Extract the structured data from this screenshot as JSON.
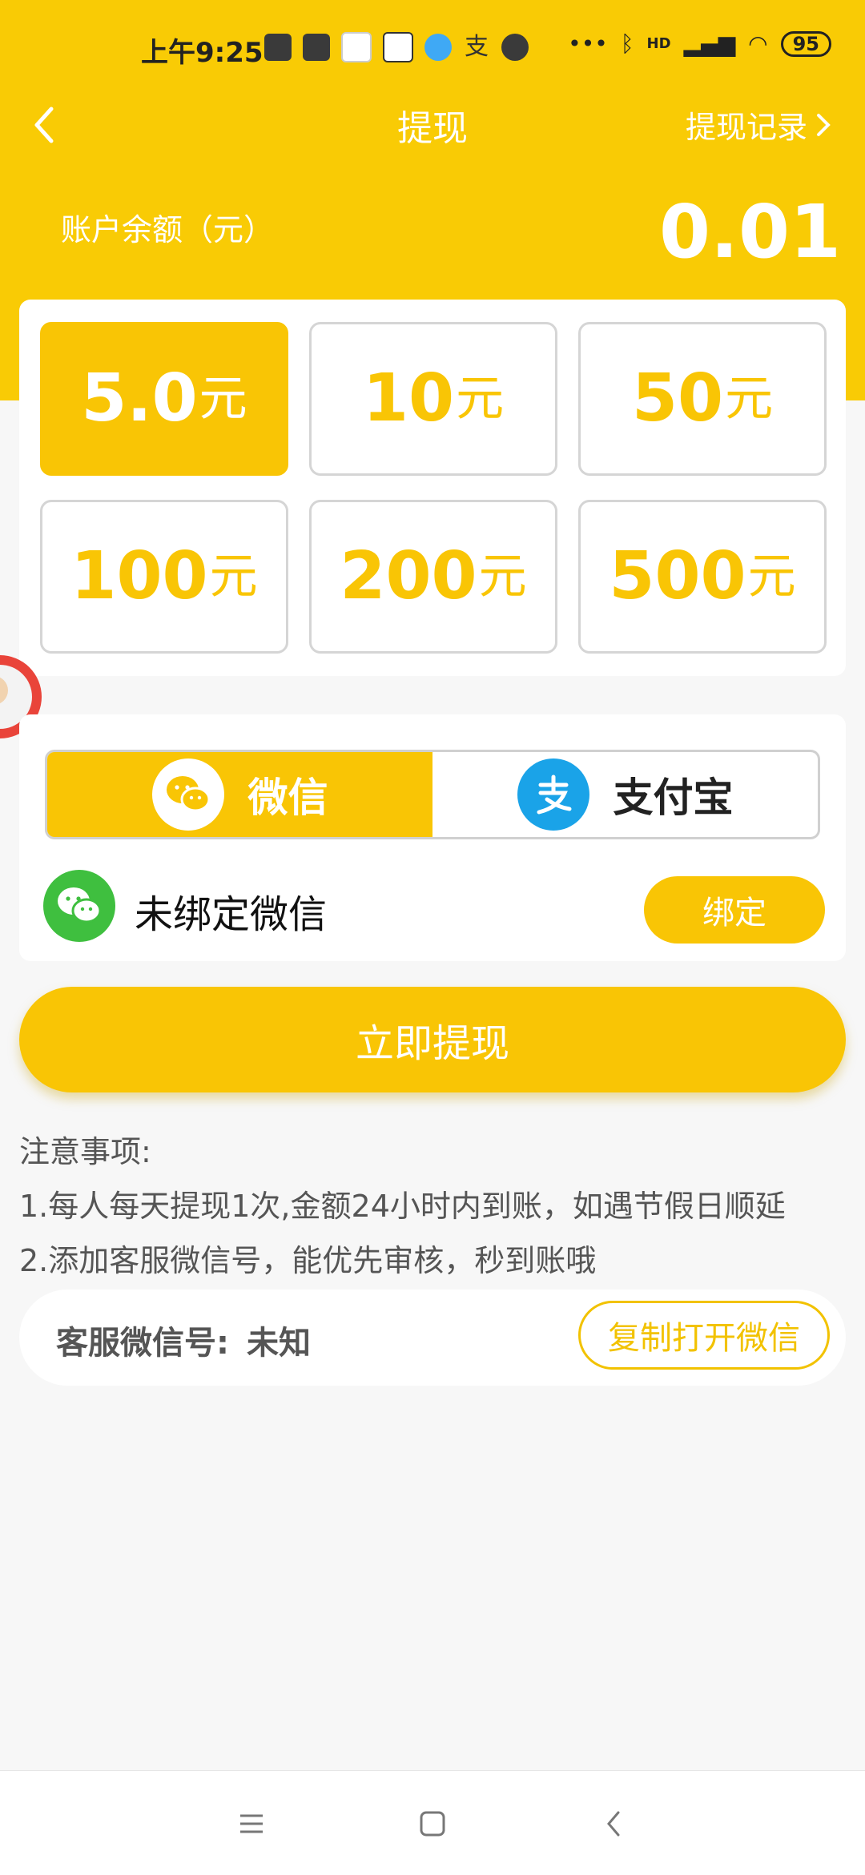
{
  "status_bar": {
    "time": "上午9:25",
    "battery": "95",
    "signal_label": "HD"
  },
  "header": {
    "title": "提现",
    "history_link": "提现记录",
    "back_icon": "back-arrow-icon"
  },
  "balance": {
    "label": "账户余额（元）",
    "value": "0.01"
  },
  "amounts": {
    "unit": "元",
    "options": [
      {
        "value": "5.0",
        "selected": true
      },
      {
        "value": "10",
        "selected": false
      },
      {
        "value": "50",
        "selected": false
      },
      {
        "value": "100",
        "selected": false
      },
      {
        "value": "200",
        "selected": false
      },
      {
        "value": "500",
        "selected": false
      }
    ]
  },
  "payment": {
    "tabs": [
      {
        "label": "微信",
        "icon": "wechat-icon",
        "active": true
      },
      {
        "label": "支付宝",
        "icon": "alipay-icon",
        "active": false
      }
    ],
    "bind_status": "未绑定微信",
    "bind_button": "绑定"
  },
  "withdraw_button": "立即提现",
  "notes": {
    "title": "注意事项:",
    "items": [
      "1.每人每天提现1次,金额24小时内到账，如遇节假日顺延",
      "2.添加客服微信号，能优先审核，秒到账哦"
    ]
  },
  "service": {
    "label": "客服微信号:",
    "value": "未知",
    "copy_button": "复制打开微信"
  },
  "colors": {
    "accent": "#f9c505",
    "wechat_green": "#3fbf3f",
    "alipay_blue": "#1aa3e8"
  }
}
